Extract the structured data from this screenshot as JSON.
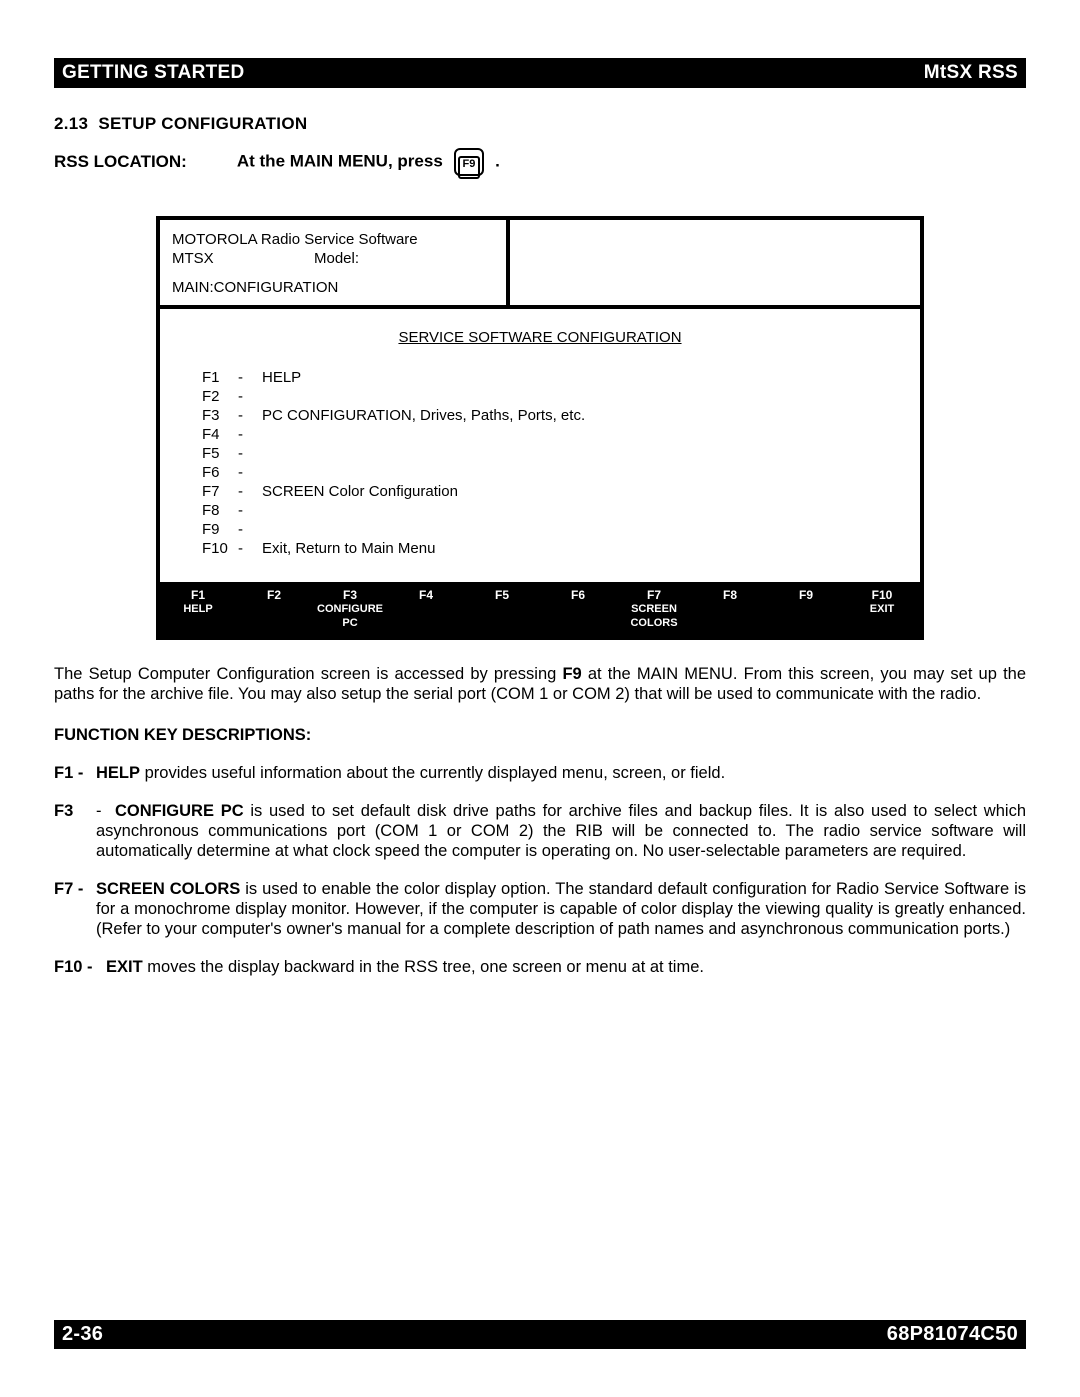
{
  "header": {
    "left": "GETTING STARTED",
    "right": "MtSX RSS"
  },
  "section": {
    "number": "2.13",
    "title": "SETUP CONFIGURATION"
  },
  "rss": {
    "label": "RSS LOCATION:",
    "instr_pre": "At the MAIN MENU, press",
    "key": "F9",
    "instr_post": "."
  },
  "screen": {
    "line1": "MOTOROLA Radio Service Software",
    "mtsx": "MTSX",
    "model_label": "Model:",
    "main_config": "MAIN:CONFIGURATION",
    "title": "SERVICE SOFTWARE CONFIGURATION",
    "menu": [
      {
        "k": "F1",
        "t": "HELP"
      },
      {
        "k": "F2",
        "t": ""
      },
      {
        "k": "F3",
        "t": "PC CONFIGURATION, Drives, Paths, Ports, etc."
      },
      {
        "k": "F4",
        "t": ""
      },
      {
        "k": "F5",
        "t": ""
      },
      {
        "k": "F6",
        "t": ""
      },
      {
        "k": "F7",
        "t": "SCREEN Color Configuration"
      },
      {
        "k": "F8",
        "t": ""
      },
      {
        "k": "F9",
        "t": ""
      },
      {
        "k": "F10",
        "t": "Exit, Return to Main Menu"
      }
    ],
    "fkeys": [
      {
        "n": "F1",
        "l1": "HELP",
        "l2": ""
      },
      {
        "n": "F2",
        "l1": "",
        "l2": ""
      },
      {
        "n": "F3",
        "l1": "CONFIGURE",
        "l2": "PC"
      },
      {
        "n": "F4",
        "l1": "",
        "l2": ""
      },
      {
        "n": "F5",
        "l1": "",
        "l2": ""
      },
      {
        "n": "F6",
        "l1": "",
        "l2": ""
      },
      {
        "n": "F7",
        "l1": "SCREEN",
        "l2": "COLORS"
      },
      {
        "n": "F8",
        "l1": "",
        "l2": ""
      },
      {
        "n": "F9",
        "l1": "",
        "l2": ""
      },
      {
        "n": "F10",
        "l1": "EXIT",
        "l2": ""
      }
    ]
  },
  "para1": "The Setup Computer Configuration screen is accessed by pressing F9 at the MAIN MENU. From this screen, you may set up the paths for the archive file. You may also setup the serial port (COM 1 or COM 2) that will be used to communicate with the radio.",
  "subhead": "FUNCTION KEY DESCRIPTIONS:",
  "desc": {
    "f1": {
      "k": "F1 -",
      "b": "HELP",
      "t": " provides useful information about the currently displayed menu, screen, or field."
    },
    "f3": {
      "k": "F3",
      "post_k": " -",
      "b": "CONFIGURE PC",
      "t": " is used to set default disk drive paths for archive files and backup files. It is also used to select which asynchronous communications port (COM 1 or COM 2) the RIB will be connected to. The radio service software will automatically determine at what clock speed the computer is operating on. No user-selectable parameters are required."
    },
    "f7": {
      "k": "F7 -",
      "b": "SCREEN COLORS",
      "t": " is used to enable the color display option. The standard default configuration for Radio Service Software is for a monochrome display monitor. However, if the computer is capable of color display the viewing quality is greatly enhanced. (Refer to your computer's owner's manual for a complete description of path names and asynchronous communication ports.)"
    },
    "f10": {
      "k": "F10 -",
      "b": "EXIT",
      "t": " moves the display backward in the RSS tree, one screen or menu at at time."
    }
  },
  "footer": {
    "left": "2-36",
    "right": "68P81074C50"
  }
}
